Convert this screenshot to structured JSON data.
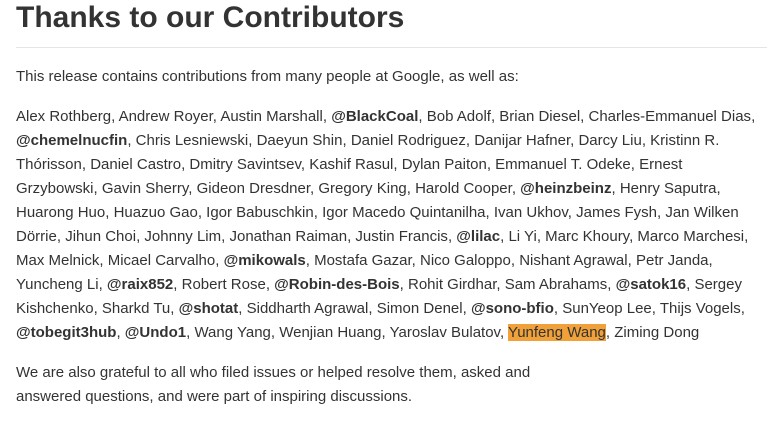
{
  "heading": "Thanks to our Contributors",
  "intro": "This release contains contributions from many people at Google, as well as:",
  "contributors": [
    {
      "text": "Alex Rothberg"
    },
    {
      "text": "Andrew Royer"
    },
    {
      "text": "Austin Marshall"
    },
    {
      "text": "@BlackCoal",
      "bold": true
    },
    {
      "text": "Bob Adolf"
    },
    {
      "text": "Brian Diesel"
    },
    {
      "text": "Charles-Emmanuel Dias"
    },
    {
      "text": "@chemelnucfin",
      "bold": true
    },
    {
      "text": "Chris Lesniewski"
    },
    {
      "text": "Daeyun Shin"
    },
    {
      "text": "Daniel Rodriguez"
    },
    {
      "text": "Danijar Hafner"
    },
    {
      "text": "Darcy Liu"
    },
    {
      "text": "Kristinn R. Thórisson"
    },
    {
      "text": "Daniel Castro"
    },
    {
      "text": "Dmitry Savintsev"
    },
    {
      "text": "Kashif Rasul"
    },
    {
      "text": "Dylan Paiton"
    },
    {
      "text": "Emmanuel T. Odeke"
    },
    {
      "text": "Ernest Grzybowski"
    },
    {
      "text": "Gavin Sherry"
    },
    {
      "text": "Gideon Dresdner"
    },
    {
      "text": "Gregory King"
    },
    {
      "text": "Harold Cooper"
    },
    {
      "text": "@heinzbeinz",
      "bold": true
    },
    {
      "text": "Henry Saputra"
    },
    {
      "text": "Huarong Huo"
    },
    {
      "text": "Huazuo Gao"
    },
    {
      "text": "Igor Babuschkin"
    },
    {
      "text": "Igor Macedo Quintanilha"
    },
    {
      "text": "Ivan Ukhov"
    },
    {
      "text": "James Fysh"
    },
    {
      "text": "Jan Wilken Dörrie"
    },
    {
      "text": "Jihun Choi"
    },
    {
      "text": "Johnny Lim"
    },
    {
      "text": "Jonathan Raiman"
    },
    {
      "text": "Justin Francis"
    },
    {
      "text": "@lilac",
      "bold": true
    },
    {
      "text": "Li Yi"
    },
    {
      "text": "Marc Khoury"
    },
    {
      "text": "Marco Marchesi"
    },
    {
      "text": "Max Melnick"
    },
    {
      "text": "Micael Carvalho"
    },
    {
      "text": "@mikowals",
      "bold": true
    },
    {
      "text": "Mostafa Gazar"
    },
    {
      "text": "Nico Galoppo"
    },
    {
      "text": "Nishant Agrawal"
    },
    {
      "text": "Petr Janda"
    },
    {
      "text": "Yuncheng Li"
    },
    {
      "text": "@raix852",
      "bold": true
    },
    {
      "text": "Robert Rose"
    },
    {
      "text": "@Robin-des-Bois",
      "bold": true
    },
    {
      "text": "Rohit Girdhar"
    },
    {
      "text": "Sam Abrahams"
    },
    {
      "text": "@satok16",
      "bold": true
    },
    {
      "text": "Sergey Kishchenko"
    },
    {
      "text": "Sharkd Tu"
    },
    {
      "text": "@shotat",
      "bold": true
    },
    {
      "text": "Siddharth Agrawal"
    },
    {
      "text": "Simon Denel"
    },
    {
      "text": "@sono-bfio",
      "bold": true
    },
    {
      "text": "SunYeop Lee"
    },
    {
      "text": "Thijs Vogels"
    },
    {
      "text": "@tobegit3hub",
      "bold": true
    },
    {
      "text": "@Undo1",
      "bold": true
    },
    {
      "text": "Wang Yang"
    },
    {
      "text": "Wenjian Huang"
    },
    {
      "text": "Yaroslav Bulatov"
    },
    {
      "text": "Yunfeng Wang",
      "highlighted": true
    },
    {
      "text": "Ziming Dong"
    }
  ],
  "separator": ", ",
  "highlight_color": "#f0a13a",
  "closing": "We are also grateful to all who filed issues or helped resolve them, asked and answered questions, and were part of inspiring discussions."
}
